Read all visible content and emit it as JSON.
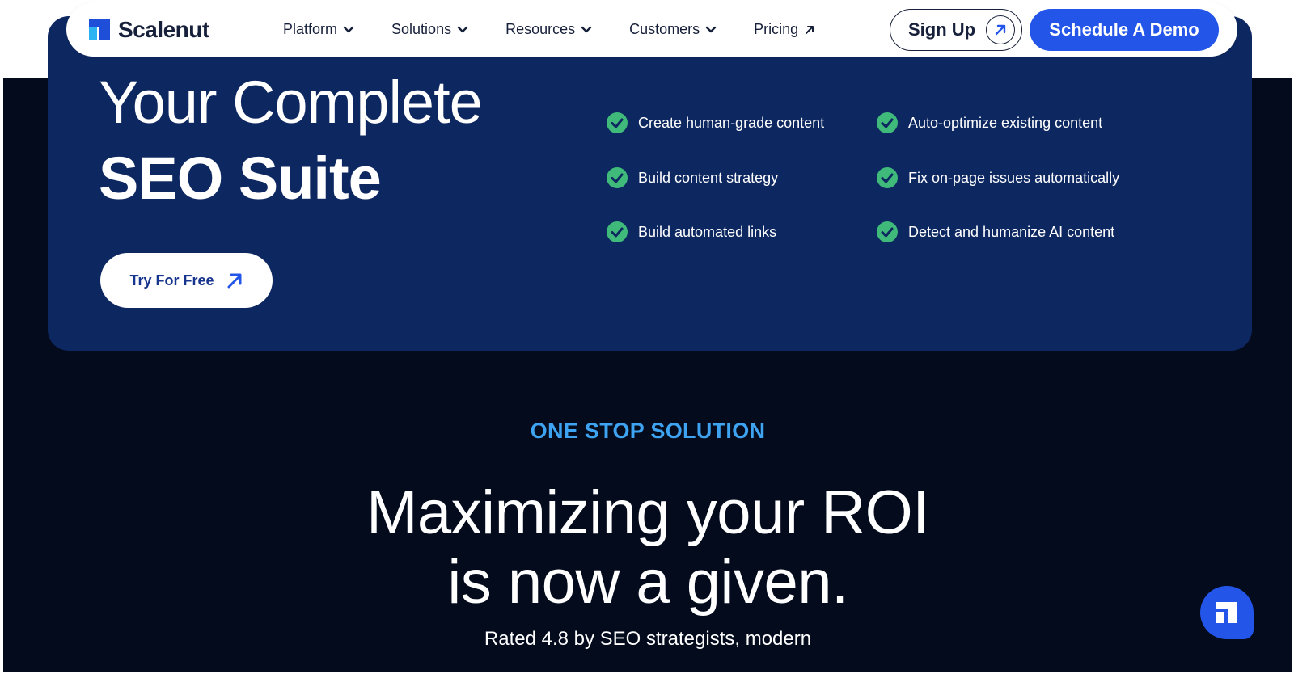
{
  "brand": {
    "name": "Scalenut"
  },
  "nav": {
    "items": [
      {
        "label": "Platform",
        "icon": "chevron-down-icon"
      },
      {
        "label": "Solutions",
        "icon": "chevron-down-icon"
      },
      {
        "label": "Resources",
        "icon": "chevron-down-icon"
      },
      {
        "label": "Customers",
        "icon": "chevron-down-icon"
      },
      {
        "label": "Pricing",
        "icon": "arrow-up-right-icon"
      }
    ],
    "signup_label": "Sign Up",
    "demo_label": "Schedule A Demo"
  },
  "hero": {
    "title_line1": "Your Complete",
    "title_line2": "SEO Suite",
    "cta_label": "Try For Free",
    "features": [
      "Create human-grade content",
      "Auto-optimize existing content",
      "Build content strategy",
      "Fix on-page issues automatically",
      "Build automated links",
      "Detect and humanize AI content"
    ]
  },
  "section": {
    "eyebrow": "ONE STOP SOLUTION",
    "heading_line1": "Maximizing your ROI",
    "heading_line2": "is now a given.",
    "subtext": "Rated 4.8 by SEO strategists, modern"
  },
  "colors": {
    "accent": "#2355e8",
    "hero_bg": "#0d2760",
    "page_bg": "#040b1d",
    "check": "#3fba7a",
    "eyebrow": "#3ea3f0"
  }
}
